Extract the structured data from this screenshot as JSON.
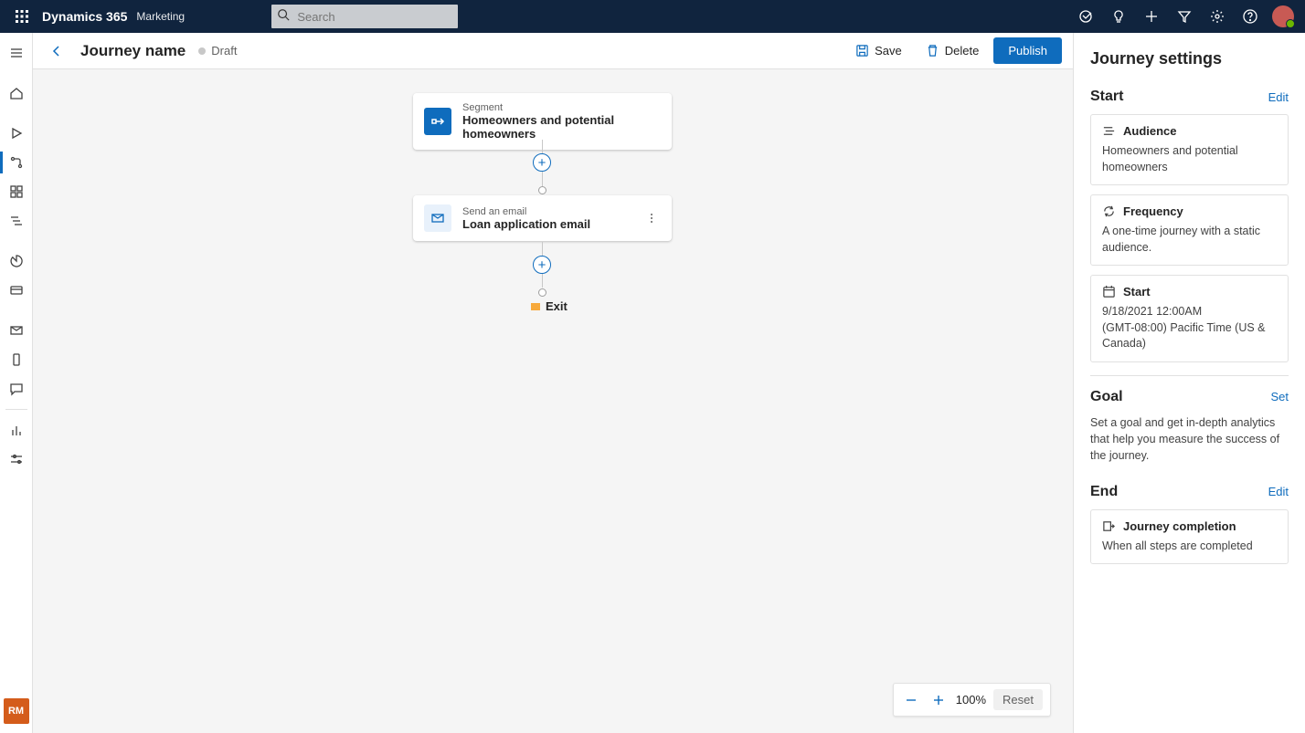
{
  "header": {
    "appName": "Dynamics 365",
    "appSub": "Marketing",
    "searchPlaceholder": "Search"
  },
  "railTag": "RM",
  "commandBar": {
    "pageTitle": "Journey name",
    "status": "Draft",
    "save": "Save",
    "delete": "Delete",
    "publish": "Publish"
  },
  "canvas": {
    "segment": {
      "type": "Segment",
      "title": "Homeowners and potential homeowners"
    },
    "email": {
      "type": "Send an email",
      "title": "Loan application email"
    },
    "exit": "Exit"
  },
  "zoom": {
    "level": "100%",
    "reset": "Reset"
  },
  "panel": {
    "title": "Journey settings",
    "start": {
      "heading": "Start",
      "editLink": "Edit",
      "audience": {
        "label": "Audience",
        "value": "Homeowners and potential homeowners"
      },
      "frequency": {
        "label": "Frequency",
        "value": "A one-time journey with a static audience."
      },
      "startCard": {
        "label": "Start",
        "value1": "9/18/2021 12:00AM",
        "value2": "(GMT-08:00) Pacific Time (US & Canada)"
      }
    },
    "goal": {
      "heading": "Goal",
      "link": "Set",
      "text": "Set a goal and get in-depth analytics that help you measure the success of the journey."
    },
    "end": {
      "heading": "End",
      "link": "Edit",
      "card": {
        "label": "Journey completion",
        "value": "When all steps are completed"
      }
    }
  }
}
